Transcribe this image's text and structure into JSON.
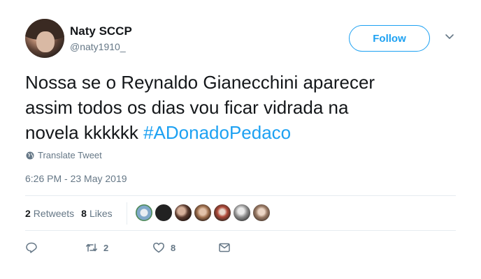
{
  "user": {
    "name": "Naty SCCP",
    "handle": "@naty1910_"
  },
  "follow_label": "Follow",
  "tweet": {
    "line1": "Nossa se o Reynaldo Gianecchini  aparecer",
    "line2": "assim todos os dias vou ficar vidrada na",
    "line3_prefix": "novela kkkkkk ",
    "hashtag": "#ADonadoPedaco"
  },
  "translate_label": "Translate Tweet",
  "timestamp": "6:26 PM - 23 May 2019",
  "stats": {
    "retweets_count": "2",
    "retweets_label": "Retweets",
    "likes_count": "8",
    "likes_label": "Likes"
  },
  "likers": [
    {
      "color": "#7fa8c9"
    },
    {
      "color": "#222222"
    },
    {
      "color": "#5a3a2e"
    },
    {
      "color": "#a0714f"
    },
    {
      "color": "#b04a3a"
    },
    {
      "color": "#8d8d8d"
    },
    {
      "color": "#9a7b66"
    }
  ],
  "actions": {
    "reply_count": "",
    "retweet_count": "2",
    "like_count": "8"
  },
  "colors": {
    "accent": "#1da1f2",
    "secondary_text": "#657786"
  }
}
